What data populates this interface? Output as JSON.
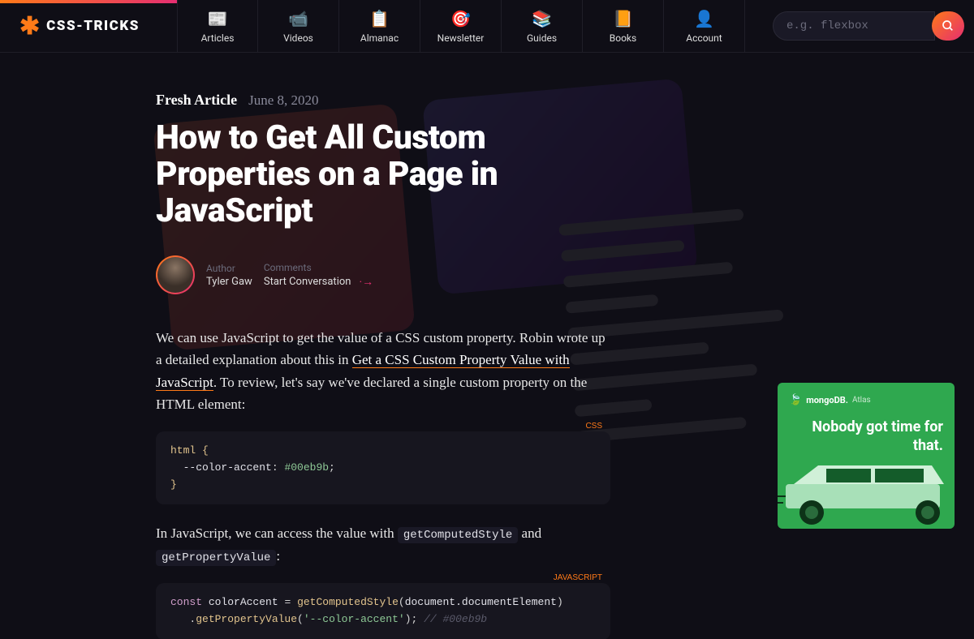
{
  "site": {
    "name": "CSS-TRICKS",
    "nav": [
      {
        "label": "Articles",
        "icon": "📰"
      },
      {
        "label": "Videos",
        "icon": "📹"
      },
      {
        "label": "Almanac",
        "icon": "📋"
      },
      {
        "label": "Newsletter",
        "icon": "🎯"
      },
      {
        "label": "Guides",
        "icon": "📚"
      },
      {
        "label": "Books",
        "icon": "📙"
      },
      {
        "label": "Account",
        "icon": "👤"
      }
    ],
    "search_placeholder": "e.g. flexbox"
  },
  "article": {
    "fresh_label": "Fresh Article",
    "date": "June 8, 2020",
    "title": "How to Get All Custom Properties on a Page in JavaScript",
    "author_label": "Author",
    "author_name": "Tyler Gaw",
    "comments_label": "Comments",
    "comments_link": "Start Conversation",
    "para1_a": "We can use JavaScript to get the value of a CSS custom property. Robin wrote up a detailed explanation about this in ",
    "para1_link": "Get a CSS Custom Property Value with JavaScript",
    "para1_b": ". To review, let's say we've declared a single custom property on the HTML element:",
    "code1_lang": "CSS",
    "code1": {
      "l1": "html {",
      "l2_prop": "--color-accent",
      "l2_val": "#00eb9b",
      "l3": "}"
    },
    "para2_a": "In JavaScript, we can access the value with ",
    "para2_code1": "getComputedStyle",
    "para2_b": " and ",
    "para2_code2": "getPropertyValue",
    "para2_c": ":",
    "code2_lang": "JavaScript",
    "code2": {
      "kw": "const",
      "var": "colorAccent",
      "fn1": "getComputedStyle",
      "arg1": "document.documentElement",
      "fn2": "getPropertyValue",
      "str": "'--color-accent'",
      "comment": "// #00eb9b"
    }
  },
  "ad": {
    "brand_main": "mongoDB.",
    "brand_sub": "Atlas",
    "headline": "Nobody got time for that."
  }
}
